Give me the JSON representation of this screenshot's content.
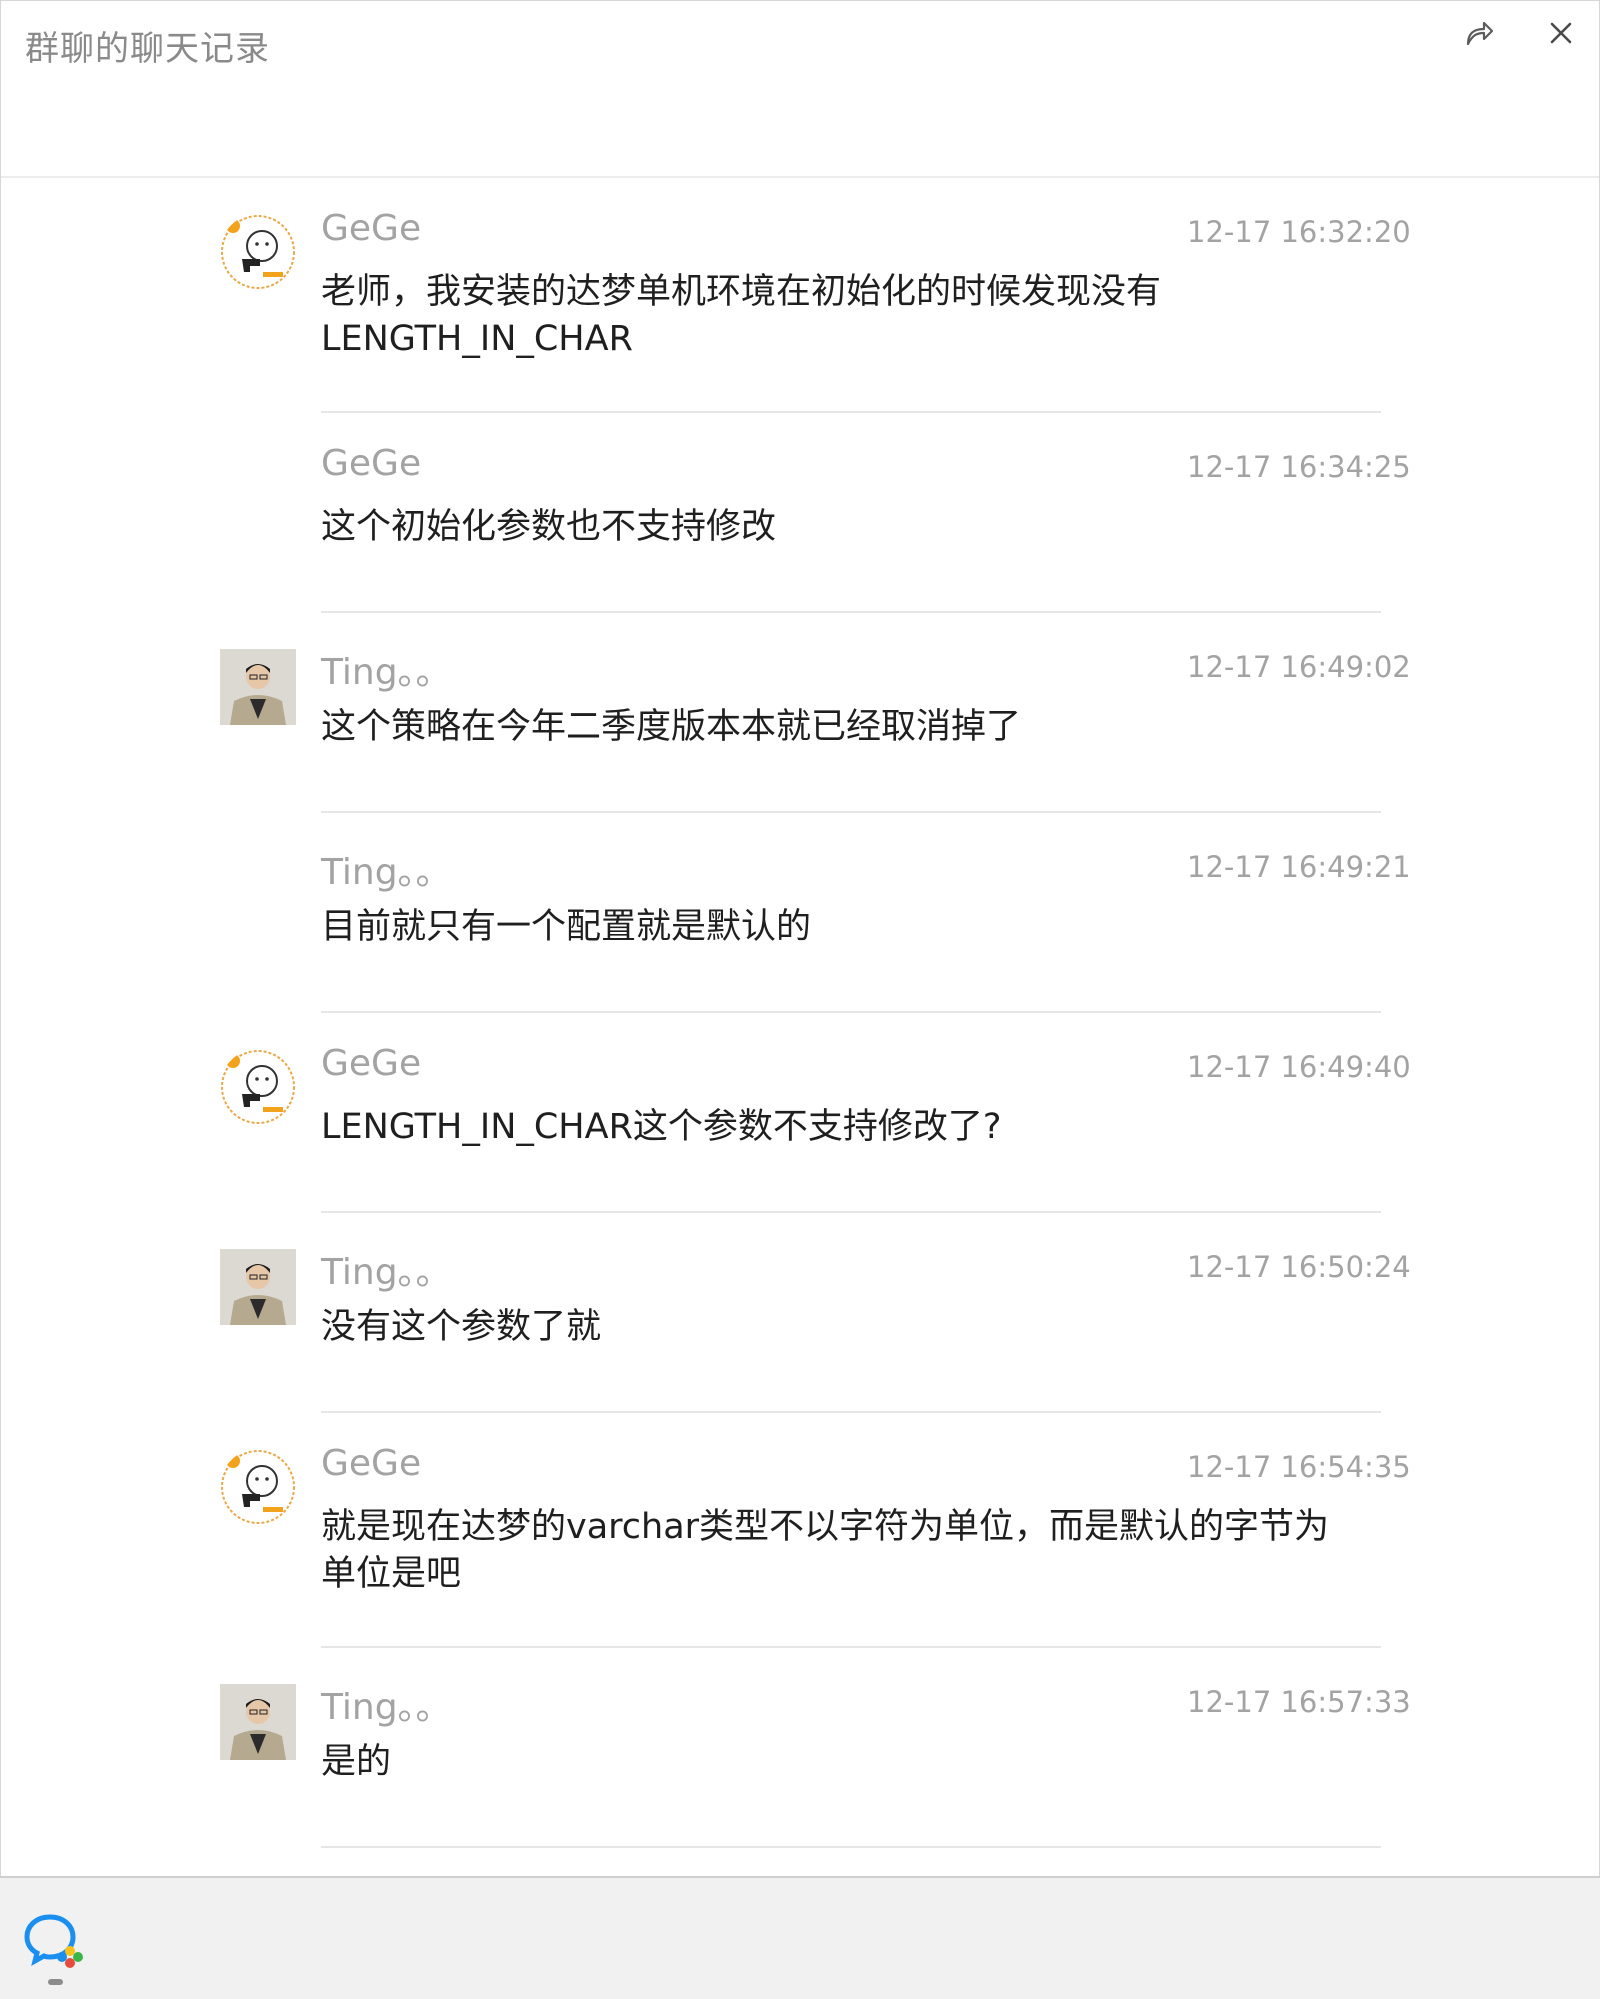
{
  "window": {
    "title": "群聊的聊天记录"
  },
  "toolbar": {
    "share_icon": "share-arrow-icon",
    "close_icon": "close-icon"
  },
  "messages": [
    {
      "sender": "GeGe",
      "time": "12-17 16:32:20",
      "text": "老师，我安装的达梦单机环境在初始化的时候发现没有\nLENGTH_IN_CHAR",
      "avatar": "gege"
    },
    {
      "sender": "GeGe",
      "time": "12-17 16:34:25",
      "text": "这个初始化参数也不支持修改",
      "avatar": ""
    },
    {
      "sender": "Ting。。",
      "time": "12-17 16:49:02",
      "text": "这个策略在今年二季度版本本就已经取消掉了",
      "avatar": "ting"
    },
    {
      "sender": "Ting。。",
      "time": "12-17 16:49:21",
      "text": "目前就只有一个配置就是默认的",
      "avatar": ""
    },
    {
      "sender": "GeGe",
      "time": "12-17 16:49:40",
      "text": "LENGTH_IN_CHAR这个参数不支持修改了?",
      "avatar": "gege"
    },
    {
      "sender": "Ting。。",
      "time": "12-17 16:50:24",
      "text": "没有这个参数了就",
      "avatar": "ting"
    },
    {
      "sender": "GeGe",
      "time": "12-17 16:54:35",
      "text": "就是现在达梦的varchar类型不以字符为单位，而是默认的字节为\n单位是吧",
      "avatar": "gege"
    },
    {
      "sender": "Ting。。",
      "time": "12-17 16:57:33",
      "text": "是的",
      "avatar": "ting"
    }
  ],
  "taskbar": {
    "app_icon": "wecom-chat-icon"
  },
  "colors": {
    "meta_text": "#a3a3a3",
    "body_text": "#1f1f1f",
    "divider": "#e6e6e6",
    "taskbar": "#f1f1f1"
  }
}
